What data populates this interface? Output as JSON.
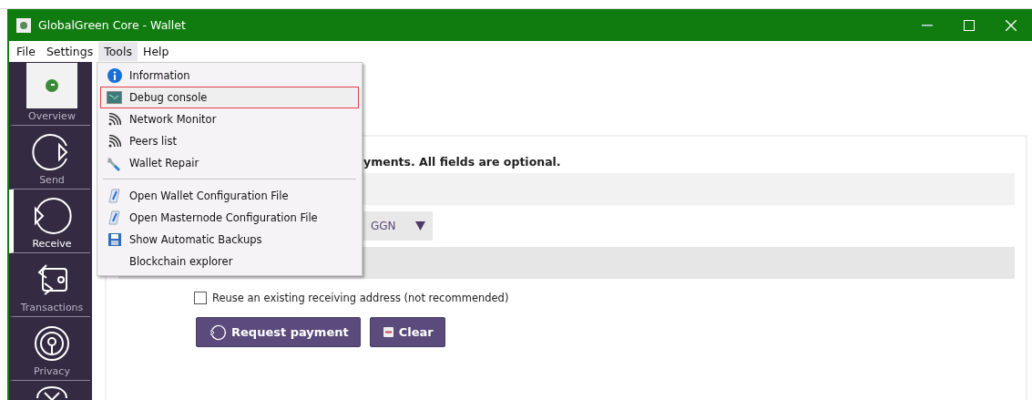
{
  "window": {
    "title": "GlobalGreen Core - Wallet"
  },
  "menu_bar": [
    {
      "label": "File",
      "selected": false
    },
    {
      "label": "Settings",
      "selected": false
    },
    {
      "label": "Tools",
      "selected": true
    },
    {
      "label": "Help",
      "selected": false
    }
  ],
  "tools_menu": [
    {
      "kind": "info",
      "label": "Information",
      "selected": false
    },
    {
      "kind": "console",
      "label": "Debug console",
      "selected": true
    },
    {
      "kind": "signal",
      "label": "Network Monitor",
      "selected": false
    },
    {
      "kind": "signal",
      "label": "Peers list",
      "selected": false
    },
    {
      "kind": "wrench",
      "label": "Wallet Repair",
      "selected": false
    },
    {
      "kind": "separator"
    },
    {
      "kind": "file",
      "label": "Open Wallet Configuration File",
      "selected": false
    },
    {
      "kind": "file",
      "label": "Open Masternode Configuration File",
      "selected": false
    },
    {
      "kind": "disk",
      "label": "Show Automatic Backups",
      "selected": false
    },
    {
      "kind": "plain",
      "label": "Blockchain explorer",
      "selected": false
    }
  ],
  "sidebar": {
    "items": [
      {
        "kind": "overview",
        "label": "Overview",
        "selected": false
      },
      {
        "kind": "send",
        "label": "Send",
        "selected": false
      },
      {
        "kind": "receive",
        "label": "Receive",
        "selected": true
      },
      {
        "kind": "transactions",
        "label": "Transactions",
        "selected": false
      },
      {
        "kind": "privacy",
        "label": "Privacy",
        "selected": false
      },
      {
        "kind": "masternodes"
      }
    ]
  },
  "receive": {
    "intro": "yments. All fields are optional.",
    "unit": "GGN",
    "reuse_address": {
      "label": "Reuse an existing receiving address (not recommended)",
      "checked": false
    },
    "buttons": [
      {
        "kind": "request",
        "label": "Request payment"
      },
      {
        "kind": "clear",
        "label": "Clear"
      }
    ]
  }
}
